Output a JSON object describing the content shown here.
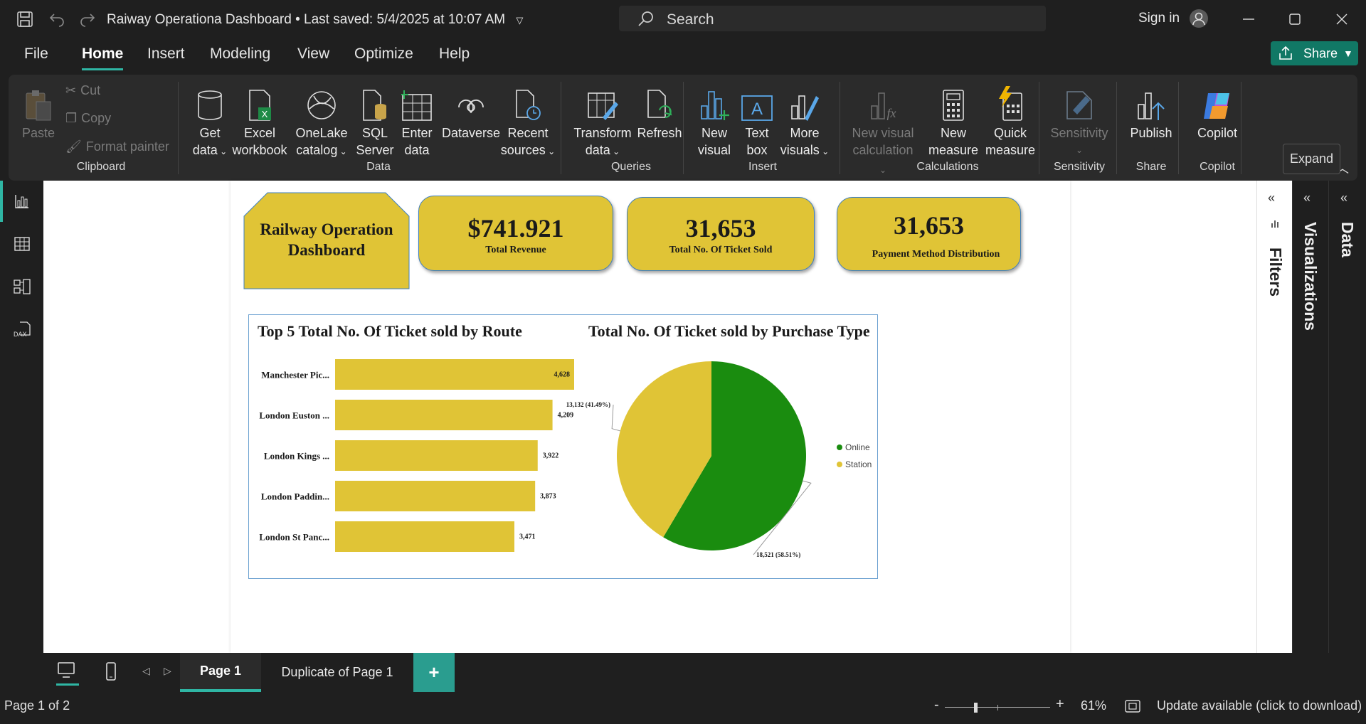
{
  "app": {
    "title": "Raiway Operationa Dashboard • Last saved: 5/4/2025 at 10:07 AM",
    "search_placeholder": "Search",
    "sign_in": "Sign in"
  },
  "menu": [
    "File",
    "Home",
    "Insert",
    "Modeling",
    "View",
    "Optimize",
    "Help"
  ],
  "share_label": "Share",
  "ribbon": {
    "clipboard": {
      "paste": "Paste",
      "cut": "Cut",
      "copy": "Copy",
      "format_painter": "Format painter",
      "group": "Clipboard"
    },
    "data": {
      "get_data": [
        "Get",
        "data"
      ],
      "excel": [
        "Excel",
        "workbook"
      ],
      "onelake": [
        "OneLake",
        "catalog"
      ],
      "sql": [
        "SQL",
        "Server"
      ],
      "enter": [
        "Enter",
        "data"
      ],
      "dataverse": "Dataverse",
      "recent": [
        "Recent",
        "sources"
      ],
      "group": "Data"
    },
    "queries": {
      "transform": [
        "Transform",
        "data"
      ],
      "refresh": "Refresh",
      "group": "Queries"
    },
    "insert": {
      "new_visual": [
        "New",
        "visual"
      ],
      "text_box": [
        "Text",
        "box"
      ],
      "more_visuals": [
        "More",
        "visuals"
      ],
      "group": "Insert"
    },
    "calculations": {
      "new_visual_calc": [
        "New visual",
        "calculation"
      ],
      "new_measure": [
        "New",
        "measure"
      ],
      "quick_measure": [
        "Quick",
        "measure"
      ],
      "group": "Calculations"
    },
    "sensitivity": {
      "label": "Sensitivity",
      "group": "Sensitivity"
    },
    "share": {
      "publish": "Publish",
      "group": "Share"
    },
    "copilot": {
      "label": "Copilot",
      "group": "Copilot"
    }
  },
  "expand_tooltip": "Expand",
  "panes": {
    "filters": "Filters",
    "visualizations": "Visualizations",
    "data": "Data"
  },
  "report": {
    "title_card": "Railway Operation Dashboard",
    "kpis": [
      {
        "value": "$741.921",
        "label": "Total Revenue"
      },
      {
        "value": "31,653",
        "label": "Total No. Of Ticket Sold"
      },
      {
        "value": "31,653",
        "label": "Payment Method Distribution"
      }
    ]
  },
  "chart_data": [
    {
      "type": "bar",
      "title": "Top 5 Total No. Of Ticket sold by Route",
      "categories": [
        "Manchester Pic...",
        "London Euston ...",
        "London Kings ...",
        "London Paddin...",
        "London St Panc..."
      ],
      "values": [
        4628,
        4209,
        3922,
        3873,
        3471
      ],
      "value_labels": [
        "4,628",
        "4,209",
        "3,922",
        "3,873",
        "3,471"
      ],
      "xlim": [
        0,
        5500
      ],
      "color": "#e0c436"
    },
    {
      "type": "pie",
      "title": "Total No. Of Ticket sold by Purchase Type",
      "series": [
        {
          "name": "Online",
          "value": 18521,
          "label": "18,521 (58.51%)",
          "color": "#1a8c0f"
        },
        {
          "name": "Station",
          "value": 13132,
          "label": "13,132 (41.49%)",
          "color": "#e0c436"
        }
      ],
      "legend": "right"
    }
  ],
  "pages": [
    "Page 1",
    "Duplicate of Page 1"
  ],
  "status": {
    "page": "Page 1 of 2",
    "zoom": "61%",
    "update": "Update available (click to download)"
  },
  "colors": {
    "accent": "#2fb6a4",
    "share": "#117865",
    "kpi": "#e0c436"
  }
}
